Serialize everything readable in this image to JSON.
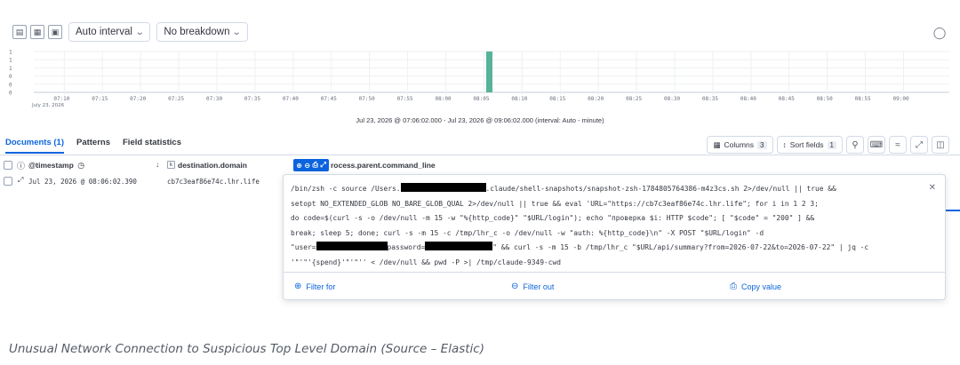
{
  "toolbar": {
    "icons": [
      "chart-type-icon",
      "table-icon",
      "save-icon"
    ],
    "interval_label": "Auto interval",
    "breakdown_label": "No breakdown"
  },
  "histogram": {
    "y_ticks": [
      "1",
      "1",
      "1",
      "0",
      "0",
      "0"
    ],
    "x_ticks": [
      "07:10",
      "07:15",
      "07:20",
      "07:25",
      "07:30",
      "07:35",
      "07:40",
      "07:45",
      "07:50",
      "07:55",
      "08:00",
      "08:05",
      "08:10",
      "08:15",
      "08:20",
      "08:25",
      "08:30",
      "08:35",
      "08:40",
      "08:45",
      "08:50",
      "08:55",
      "09:00"
    ],
    "date_label": "July 23, 2026",
    "bar": {
      "time": "08:06",
      "count": 1
    },
    "bar_color": "#54b399",
    "range_text": "Jul 23, 2026 @ 07:06:02.000 - Jul 23, 2026 @ 09:06:02.000 (interval: Auto - minute)"
  },
  "tabs": [
    {
      "label": "Documents (1)"
    },
    {
      "label": "Patterns"
    },
    {
      "label": "Field statistics"
    }
  ],
  "grid_toolbar": {
    "columns_label": "Columns",
    "columns_count": "3",
    "sort_label": "Sort fields",
    "sort_count": "1"
  },
  "columns": {
    "timestamp": "@timestamp",
    "destination": "destination.domain",
    "parent_cmd": "rocess.parent.command_line"
  },
  "row": {
    "timestamp": "Jul 23, 2026 @ 08:06:02.390",
    "destination": "cb7c3eaf86e74c.lhr.life"
  },
  "popover": {
    "lines": [
      [
        "/bin/zsh -c source /Users.",
        "",
        ".claude/shell-snapshots/snapshot-zsh-1784805764386-m4z3cs.sh 2>/dev/null || true &&"
      ],
      [
        "setopt NO_EXTENDED_GLOB NO_BARE_GLOB_QUAL 2>/dev/null || true && eval 'URL=\"https://cb7c3eaf86e74c.lhr.life\"; for i in 1 2 3;"
      ],
      [
        "do code=$(curl -s -o /dev/null -m 15 -w \"%{http_code}\" \"$URL/login\"); echo \"проверка $i: HTTP $code\"; [ \"$code\" = \"200\" ] &&"
      ],
      [
        "break; sleep 5; done; curl -s -m 15 -c /tmp/lhr_c -o /dev/null -w \"auth: %{http_code}\\n\" -X POST \"$URL/login\" -d"
      ],
      [
        "\"user=",
        "",
        "password=",
        "",
        "\" && curl -s -m 15 -b /tmp/lhr_c \"$URL/api/summary?from=2026-07-22&to=2026-07-22\" | jq -c"
      ],
      [
        "'\"'\"'{spend}'\"'\"'' < /dev/null && pwd -P >| /tmp/claude-9349-cwd"
      ]
    ],
    "filter_for": "Filter for",
    "filter_out": "Filter out",
    "copy_value": "Copy value"
  },
  "caption": "Unusual Network Connection to Suspicious Top Level Domain (Source – Elastic)"
}
